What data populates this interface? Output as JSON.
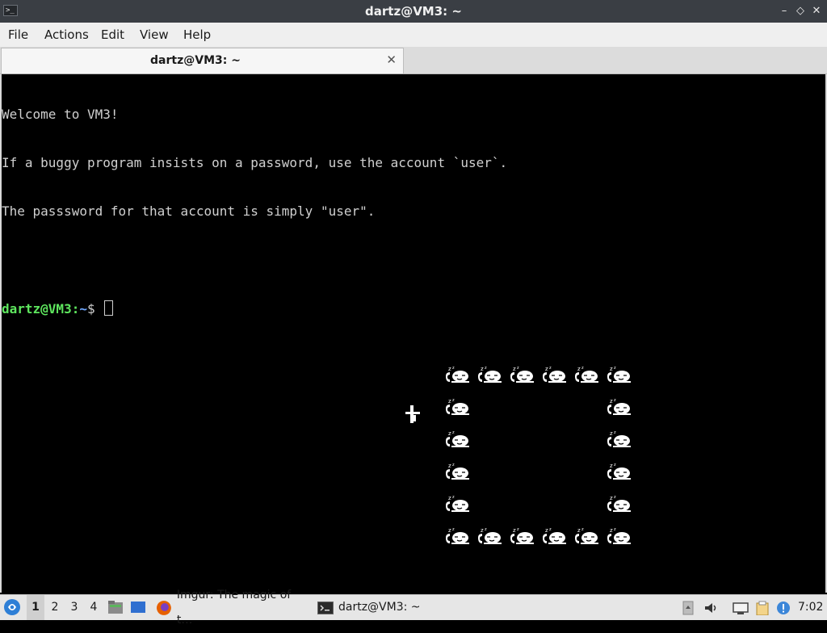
{
  "window": {
    "title": "dartz@VM3: ~",
    "controls": {
      "minimize": "–",
      "restore": "◇",
      "close": "✕"
    }
  },
  "menu": [
    "File",
    "Actions",
    "Edit",
    "View",
    "Help"
  ],
  "tab": {
    "label": "dartz@VM3: ~",
    "close": "✕"
  },
  "terminal": {
    "lines": [
      "Welcome to VM3!",
      "If a buggy program insists on a password, use the account `user`.",
      "The passsword for that account is simply \"user\".",
      ""
    ],
    "prompt_user": "dartz@VM3",
    "prompt_sep": ":",
    "prompt_path": "~",
    "prompt_symbol": "$ "
  },
  "taskbar": {
    "workspaces": [
      "1",
      "2",
      "3",
      "4"
    ],
    "active_workspace": "1",
    "tasks": [
      {
        "label": "Imgur: The magic of t…",
        "icon": "firefox-icon"
      },
      {
        "label": "dartz@VM3: ~",
        "icon": "terminal-icon"
      }
    ],
    "clock": "7:02"
  },
  "colors": {
    "titlebar": "#3a3e44",
    "terminal_bg": "#000000",
    "prompt_user": "#5ee65e",
    "prompt_path": "#6fa8ff",
    "taskbar": "#e6e6e6"
  }
}
